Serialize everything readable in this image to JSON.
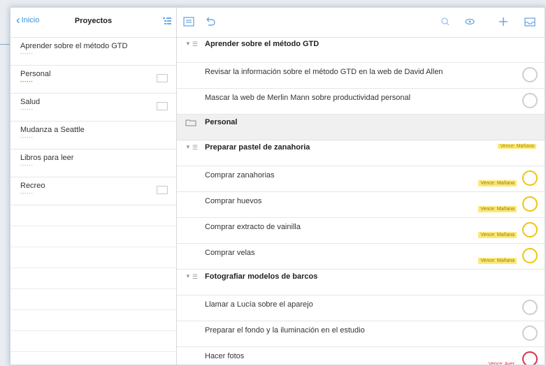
{
  "left": {
    "back_label": "Inicio",
    "title": "Proyectos",
    "projects": [
      {
        "name": "Aprender sobre el método GTD",
        "folder": false
      },
      {
        "name": "Personal",
        "folder": true
      },
      {
        "name": "Salud",
        "folder": true
      },
      {
        "name": "Mudanza a Seattle",
        "folder": false
      },
      {
        "name": "Libros para leer",
        "folder": false
      },
      {
        "name": "Recreo",
        "folder": true
      }
    ]
  },
  "toolbar": {
    "icons": [
      "list-view-icon",
      "undo-icon",
      "search-icon",
      "view-icon",
      "add-icon",
      "inbox-icon"
    ]
  },
  "groups": [
    {
      "type": "project",
      "title": "Aprender sobre el método GTD",
      "tasks": [
        {
          "name": "Revisar la información sobre el método GTD en la web de David Allen",
          "status": "normal"
        },
        {
          "name": "Mascar la web de Merlin Mann sobre productividad personal",
          "status": "normal"
        }
      ]
    },
    {
      "type": "folder",
      "title": "Personal"
    },
    {
      "type": "project",
      "title": "Preparar pastel de zanahoria",
      "right_tag": "Vence: Mañana",
      "tasks": [
        {
          "name": "Comprar zanahorias",
          "status": "yellow",
          "due": "Vence: Mañana"
        },
        {
          "name": "Comprar huevos",
          "status": "yellow",
          "due": "Vence: Mañana"
        },
        {
          "name": "Comprar extracto de vainilla",
          "status": "yellow",
          "due": "Vence: Mañana"
        },
        {
          "name": "Comprar velas",
          "status": "yellow",
          "due": "Vence: Mañana"
        }
      ]
    },
    {
      "type": "project",
      "title": "Fotografiar modelos de barcos",
      "tasks": [
        {
          "name": "Llamar a Lucía sobre el aparejo",
          "status": "normal"
        },
        {
          "name": "Preparar el fondo y la iluminación en el estudio",
          "status": "normal"
        },
        {
          "name": "Hacer fotos",
          "status": "red",
          "due": "Vence: Ayer"
        }
      ]
    }
  ]
}
